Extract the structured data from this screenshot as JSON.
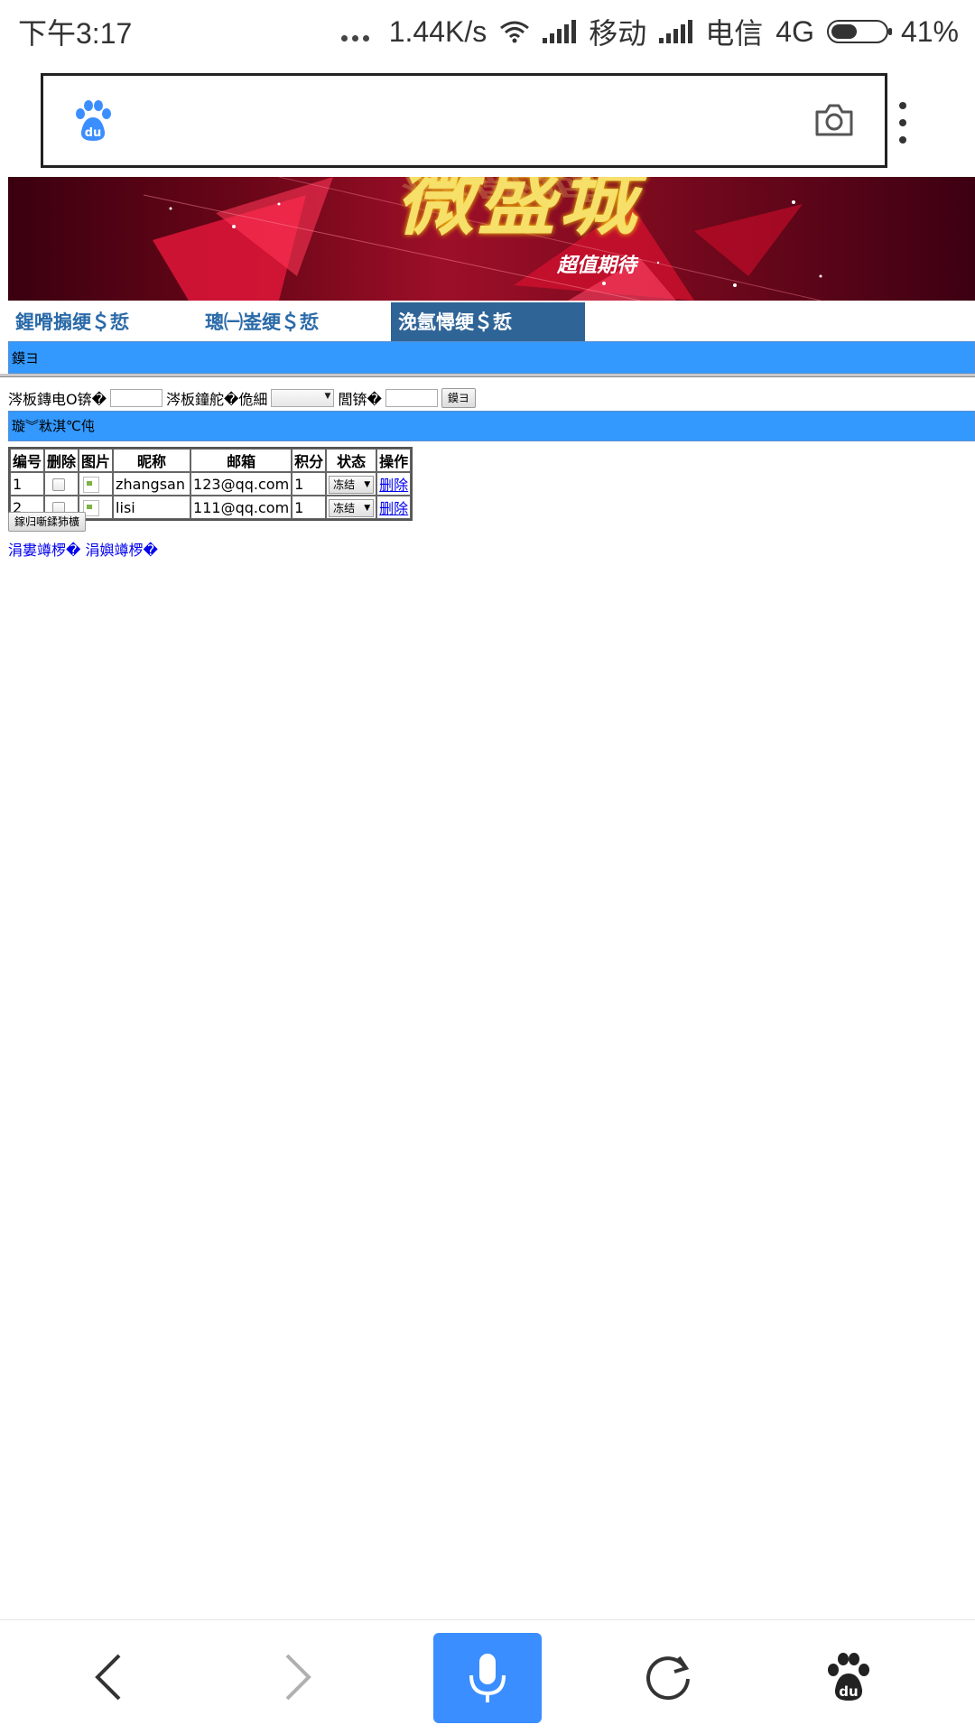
{
  "status_bar": {
    "time": "下午3:17",
    "net_speed": "1.44K/s",
    "carrier1": "移动",
    "carrier2": "电信",
    "network_type": "4G",
    "battery": "41%"
  },
  "browser": {
    "search_placeholder": ""
  },
  "banner": {
    "title": "微盛城",
    "subtitle": "超值期待"
  },
  "nav": {
    "tabs": [
      {
        "label": "鍟嗗搧绠＄悊",
        "active": false
      },
      {
        "label": "璁㈠崟绠＄悊",
        "active": false
      },
      {
        "label": "浼氬憳绠＄悊",
        "active": true
      }
    ]
  },
  "breadcrumb_bar": "鏌ヨ",
  "search_form": {
    "label1": "涔板鏄电О锛�",
    "label2": "涔板鐘舵�佹細",
    "label3": "閭锛�",
    "button": "鏌ヨ"
  },
  "list_bar": "璇︾粏淇℃伅",
  "table": {
    "headers": [
      "编号",
      "删除",
      "图片",
      "昵称",
      "邮箱",
      "积分",
      "状态",
      "操作"
    ],
    "rows": [
      {
        "id": "1",
        "nickname": "zhangsan",
        "email": "123@qq.com",
        "points": "1",
        "status": "冻结",
        "action": "删除"
      },
      {
        "id": "2",
        "nickname": "lisi",
        "email": "111@qq.com",
        "points": "1",
        "status": "冻结",
        "action": "删除"
      }
    ]
  },
  "batch_button": "鎵归噺鍒犻櫎",
  "pager": {
    "prev": "涓婁竴椤�",
    "next": "涓嬩竴椤�"
  },
  "colors": {
    "blue_bar": "#3399ff",
    "active_tab": "#2f6497",
    "mic_button": "#3b8eff"
  }
}
